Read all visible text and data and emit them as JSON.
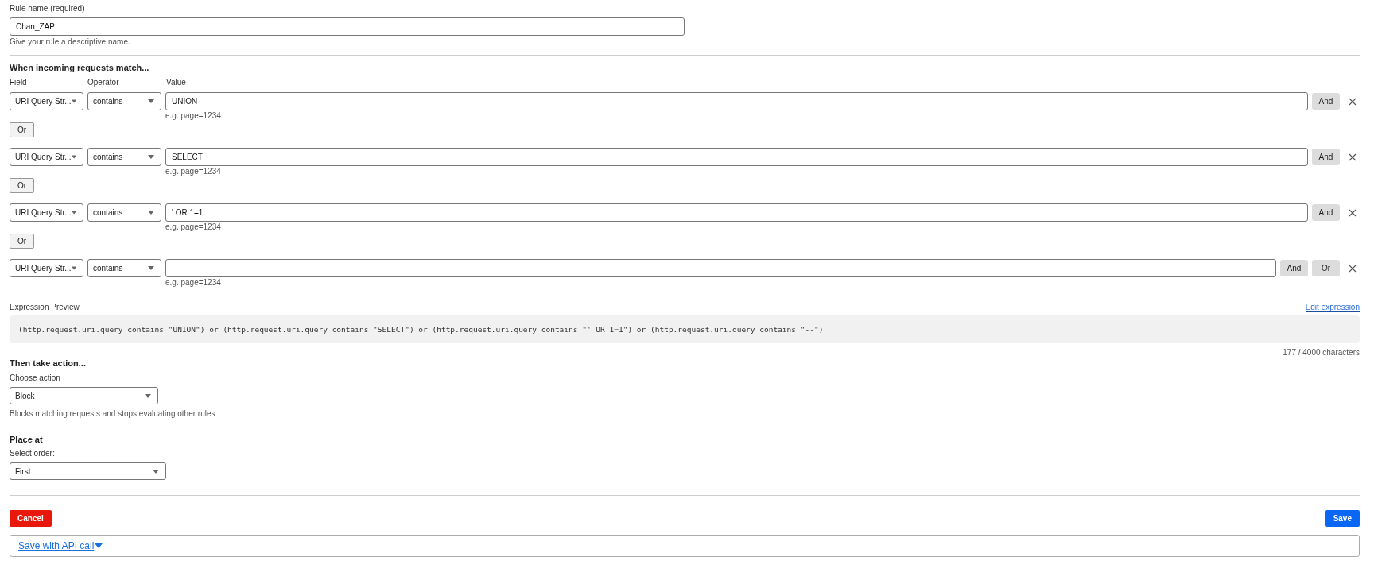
{
  "rule_name": {
    "label": "Rule name (required)",
    "value": "Chan_ZAP",
    "hint": "Give your rule a descriptive name."
  },
  "match": {
    "heading": "When incoming requests match...",
    "column_labels": [
      "Field",
      "Operator",
      "Value"
    ],
    "conditions": [
      {
        "field": "URI Query Str...",
        "operator": "contains",
        "value": "UNION",
        "hint": "e.g. page=1234",
        "buttons": [
          "And"
        ],
        "connector": "Or"
      },
      {
        "field": "URI Query Str...",
        "operator": "contains",
        "value": "SELECT",
        "hint": "e.g. page=1234",
        "buttons": [
          "And"
        ],
        "connector": "Or"
      },
      {
        "field": "URI Query Str...",
        "operator": "contains",
        "value": "' OR 1=1",
        "hint": "e.g. page=1234",
        "buttons": [
          "And"
        ],
        "connector": "Or"
      },
      {
        "field": "URI Query Str...",
        "operator": "contains",
        "value": "--",
        "hint": "e.g. page=1234",
        "buttons": [
          "And",
          "Or"
        ]
      }
    ]
  },
  "expression": {
    "label": "Expression Preview",
    "edit_link": "Edit expression",
    "text": "(http.request.uri.query contains \"UNION\") or (http.request.uri.query contains \"SELECT\") or (http.request.uri.query contains \"' OR 1=1\") or (http.request.uri.query contains \"--\")",
    "count": "177 / 4000 characters"
  },
  "action": {
    "heading": "Then take action...",
    "label": "Choose action",
    "value": "Block",
    "hint": "Blocks matching requests and stops evaluating other rules"
  },
  "place": {
    "heading": "Place at",
    "label": "Select order:",
    "value": "First"
  },
  "footer": {
    "cancel": "Cancel",
    "save": "Save",
    "api_link": "Save with API call"
  }
}
